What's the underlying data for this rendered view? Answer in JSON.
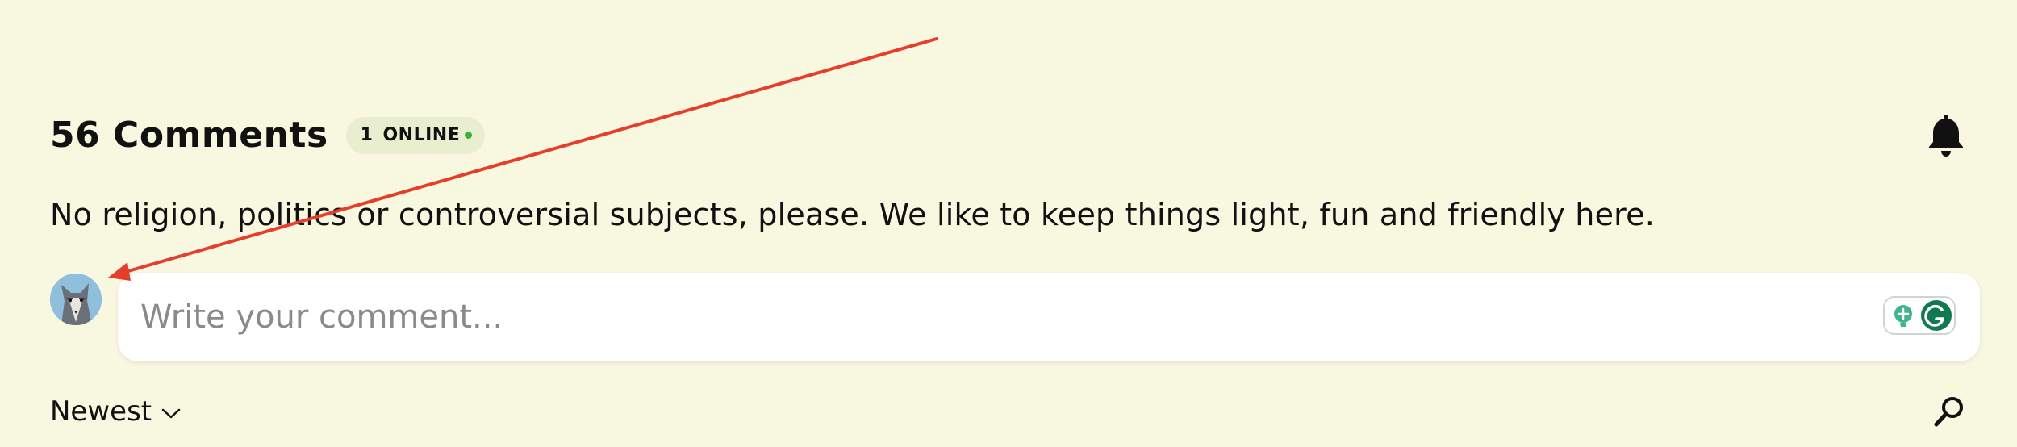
{
  "comments_header": {
    "count_title": "56 Comments",
    "online_count": "1",
    "online_label": "ONLINE"
  },
  "rules_text": "No religion, politics or controversial subjects, please. We like to keep things light, fun and friendly here.",
  "comment_input": {
    "placeholder": "Write your comment..."
  },
  "sort": {
    "selected": "Newest"
  },
  "icons": {
    "notifications": "bell-icon",
    "search": "search-icon",
    "sort_toggle": "chevron-down-icon",
    "grammarly": "grammarly-icon",
    "suggestion": "lightbulb-icon"
  },
  "colors": {
    "background": "#f8f8e1",
    "online_dot": "#3fae3a",
    "annotation_arrow": "#e53e2b"
  }
}
